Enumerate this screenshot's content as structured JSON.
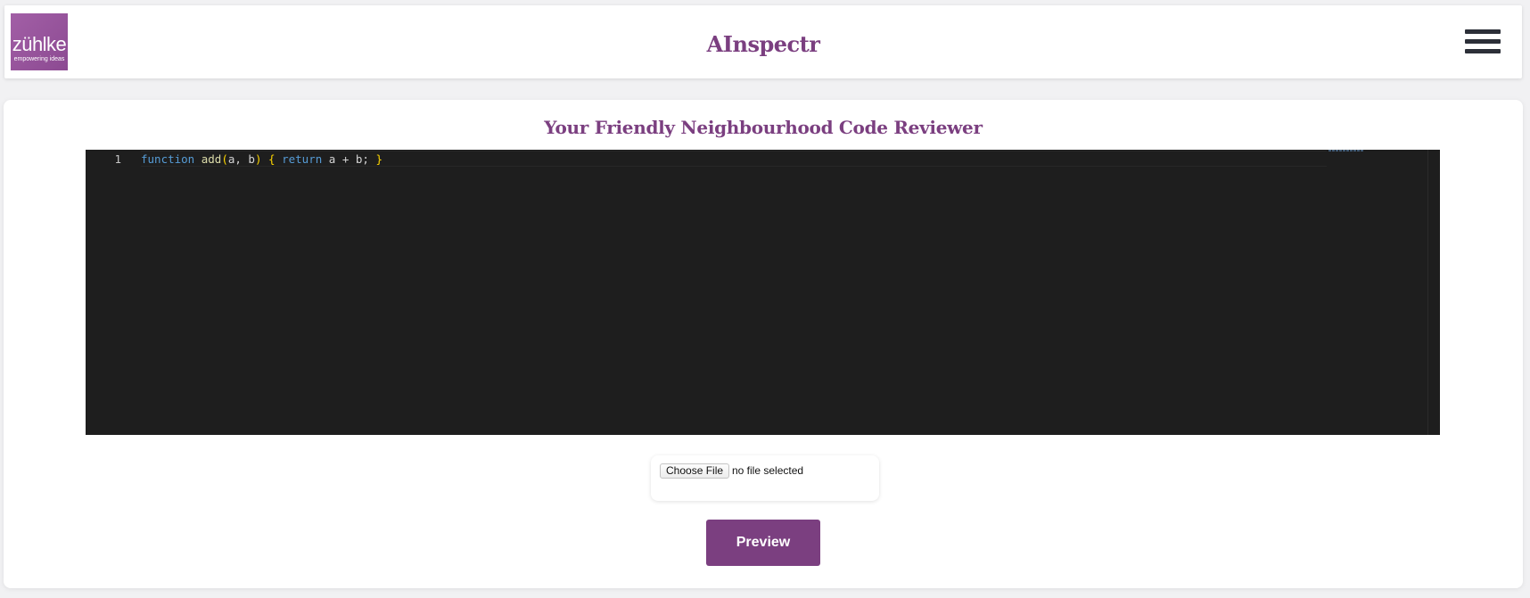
{
  "header": {
    "logo": {
      "brand": "zühlke",
      "tagline": "empowering ideas"
    },
    "title": "AInspectr",
    "menu_icon": "hamburger-menu-icon"
  },
  "main": {
    "title": "Your Friendly Neighbourhood Code Reviewer",
    "editor": {
      "line_numbers": [
        "1"
      ],
      "tokens": {
        "kw_function": "function",
        "fn_name": "add",
        "paren_open": "(",
        "params": "a, b",
        "paren_close": ")",
        "brace_open": "{",
        "kw_return": "return",
        "expr": "a + b;",
        "brace_close": "}"
      }
    },
    "file_input": {
      "button_label": "Choose File",
      "status": "no file selected"
    },
    "preview_button": "Preview"
  },
  "colors": {
    "accent": "#7b3f80",
    "logo_bg": "#9b5aa0",
    "editor_bg": "#1e1e1e",
    "keyword": "#569cd6",
    "bracket": "#ffd700"
  }
}
